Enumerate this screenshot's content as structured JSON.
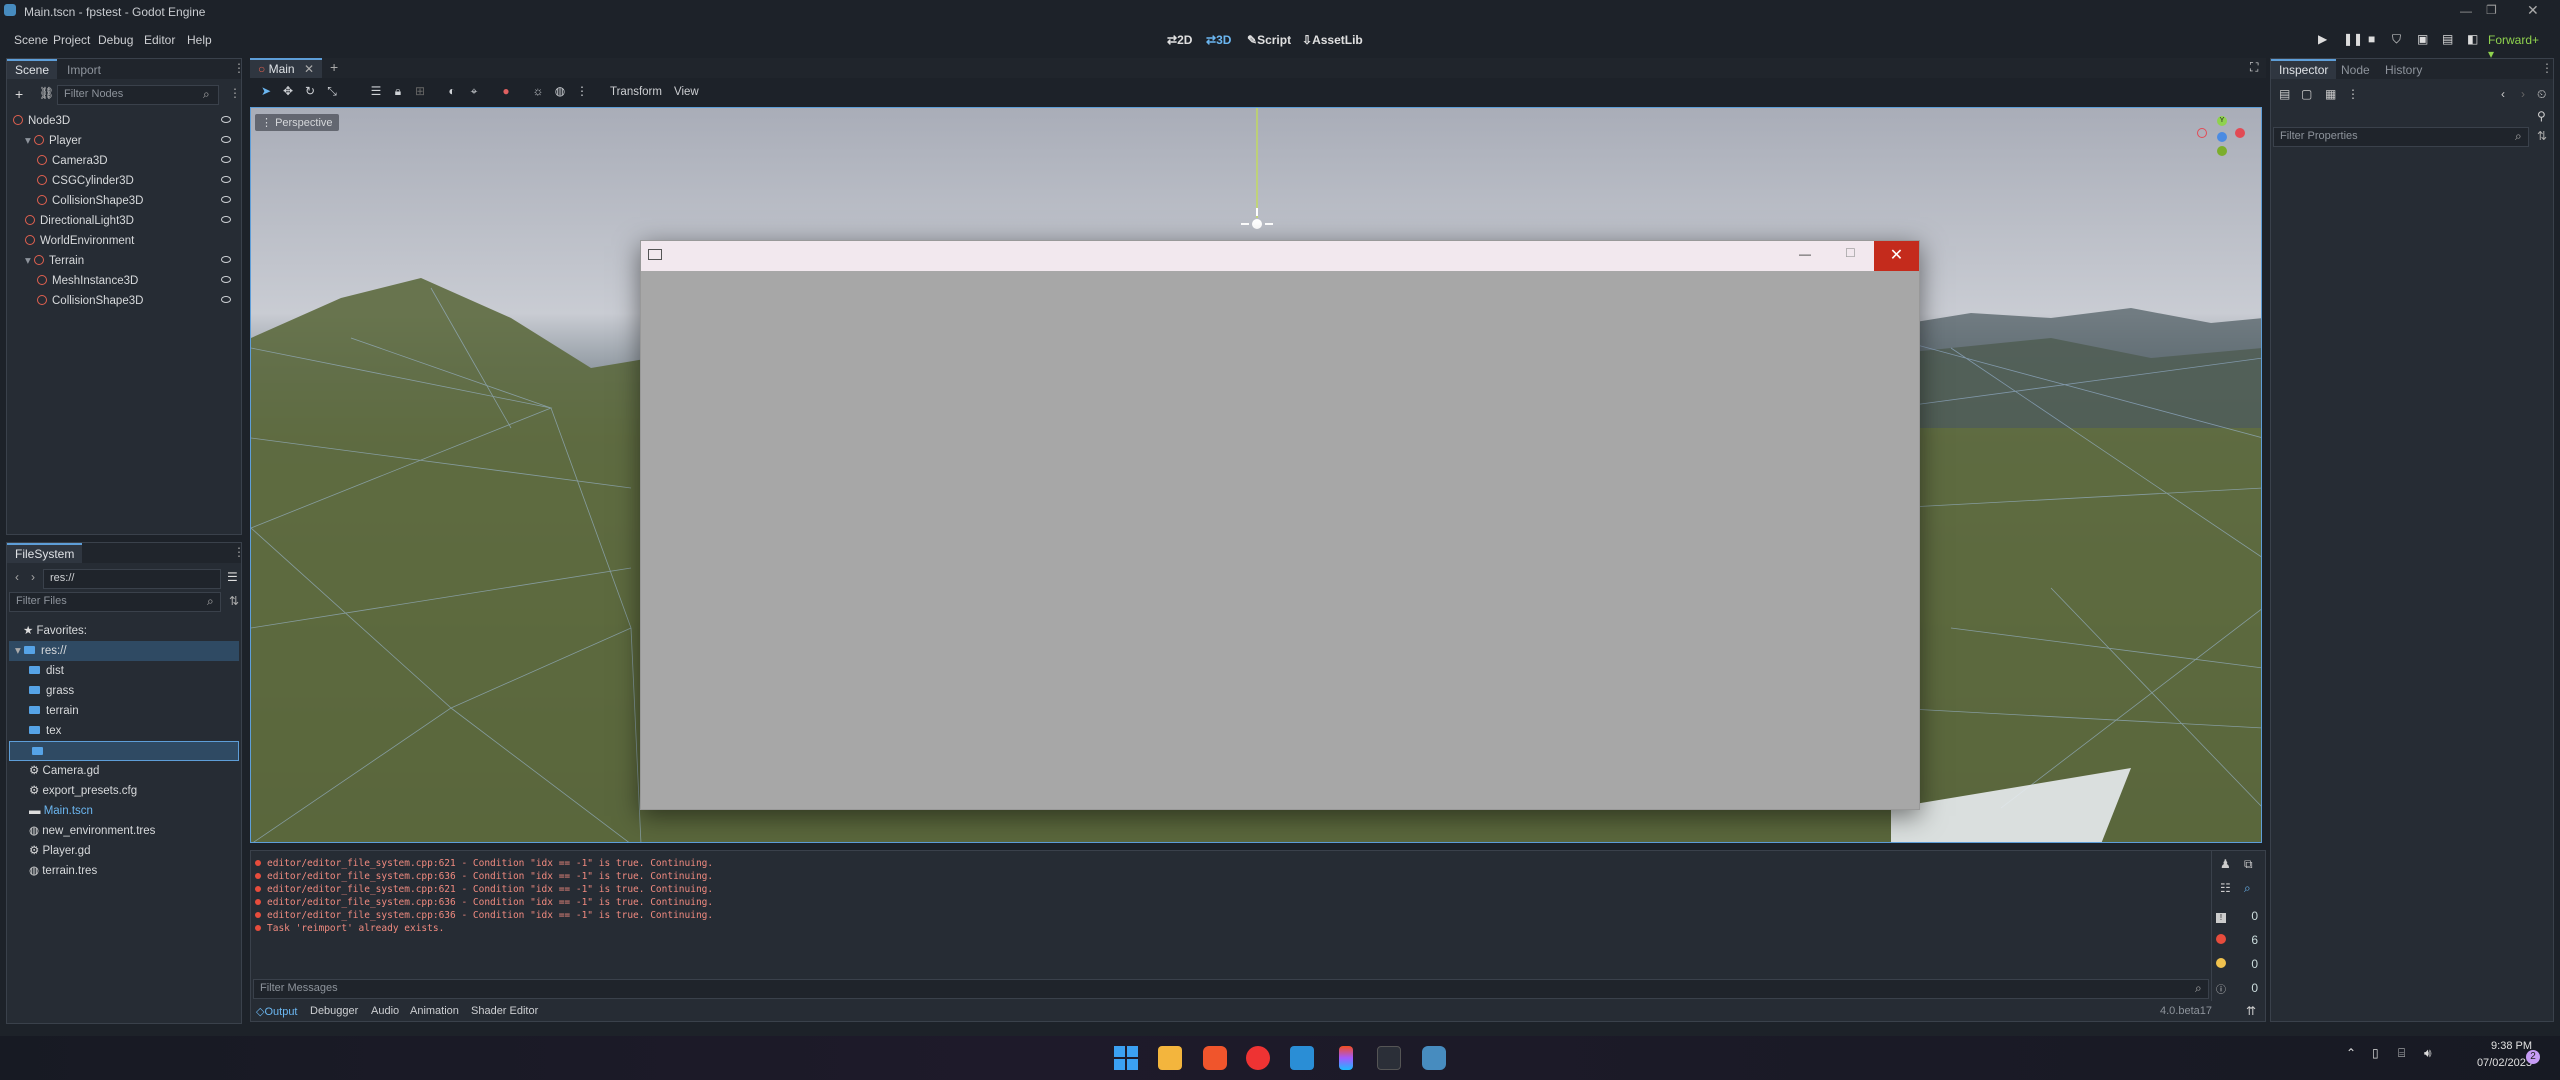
{
  "window": {
    "title": "Main.tscn - fpstest - Godot Engine"
  },
  "menu": [
    "Scene",
    "Project",
    "Debug",
    "Editor",
    "Help"
  ],
  "workspaces": {
    "w2d": "2D",
    "w3d": "3D",
    "script": "Script",
    "assetlib": "AssetLib"
  },
  "renderer": "Forward+",
  "scene_panel": {
    "tabs": [
      "Scene",
      "Import"
    ],
    "filter_placeholder": "Filter Nodes",
    "nodes": [
      {
        "label": "Node3D",
        "icon_color": "#e0604f",
        "indent": 0
      },
      {
        "label": "Player",
        "icon_color": "#e0604f",
        "indent": 1
      },
      {
        "label": "Camera3D",
        "icon_color": "#e0604f",
        "indent": 2
      },
      {
        "label": "CSGCylinder3D",
        "icon_color": "#e0604f",
        "indent": 2
      },
      {
        "label": "CollisionShape3D",
        "icon_color": "#e0604f",
        "indent": 2
      },
      {
        "label": "DirectionalLight3D",
        "icon_color": "#e0604f",
        "indent": 1
      },
      {
        "label": "WorldEnvironment",
        "icon_color": "#e0604f",
        "indent": 1
      },
      {
        "label": "Terrain",
        "icon_color": "#e0604f",
        "indent": 1
      },
      {
        "label": "MeshInstance3D",
        "icon_color": "#e0604f",
        "indent": 2
      },
      {
        "label": "CollisionShape3D",
        "icon_color": "#e0604f",
        "indent": 2
      }
    ]
  },
  "filesystem": {
    "tab": "FileSystem",
    "path": "res://",
    "filter_placeholder": "Filter Files",
    "favorites": "Favorites:",
    "root": "res://",
    "items": [
      {
        "label": "dist",
        "kind": "folder"
      },
      {
        "label": "grass",
        "kind": "folder"
      },
      {
        "label": "terrain",
        "kind": "folder"
      },
      {
        "label": "tex",
        "kind": "folder"
      },
      {
        "label": "",
        "kind": "folder-new"
      },
      {
        "label": "Camera.gd",
        "kind": "gear"
      },
      {
        "label": "export_presets.cfg",
        "kind": "gear"
      },
      {
        "label": "Main.tscn",
        "kind": "scene"
      },
      {
        "label": "new_environment.tres",
        "kind": "res"
      },
      {
        "label": "Player.gd",
        "kind": "gear"
      },
      {
        "label": "terrain.tres",
        "kind": "res"
      }
    ]
  },
  "editor_tabs": [
    "Main"
  ],
  "toolbar": {
    "transform": "Transform",
    "view": "View"
  },
  "viewport": {
    "perspective": "Perspective"
  },
  "popup_window": {
    "title": ""
  },
  "output": {
    "lines": [
      "editor/editor_file_system.cpp:621 - Condition \"idx == -1\" is true. Continuing.",
      "editor/editor_file_system.cpp:636 - Condition \"idx == -1\" is true. Continuing.",
      "editor/editor_file_system.cpp:621 - Condition \"idx == -1\" is true. Continuing.",
      "editor/editor_file_system.cpp:636 - Condition \"idx == -1\" is true. Continuing.",
      "editor/editor_file_system.cpp:636 - Condition \"idx == -1\" is true. Continuing.",
      "Task 'reimport' already exists."
    ],
    "filter_placeholder": "Filter Messages",
    "counts": {
      "messages": "0",
      "errors": "6",
      "warnings": "0",
      "info": "0"
    }
  },
  "bottom_tabs": [
    "Output",
    "Debugger",
    "Audio",
    "Animation",
    "Shader Editor"
  ],
  "version": "4.0.beta17",
  "inspector": {
    "tabs": [
      "Inspector",
      "Node",
      "History"
    ],
    "filter_placeholder": "Filter Properties"
  },
  "clock": {
    "time": "9:38 PM",
    "date": "07/02/2023"
  },
  "notifications": "2"
}
